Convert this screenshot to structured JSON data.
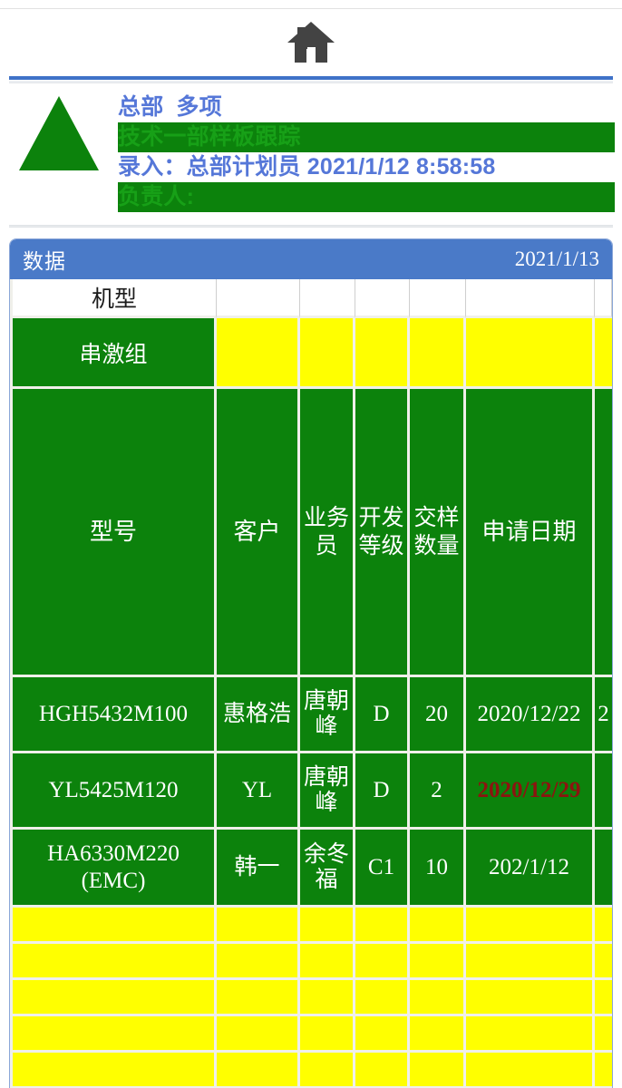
{
  "nav": {
    "home_icon": "home-icon"
  },
  "record": {
    "org_line": "总部",
    "org_type": "多项",
    "title": "技术一部样板跟踪",
    "entry_label": "录入：",
    "entry_user": "总部计划员",
    "entry_datetime": "2021/1/12 8:58:58",
    "owner_label": "负责人:",
    "marker_icon": "green-triangle-icon",
    "colors": {
      "blue": "#5577d8",
      "green": "#17a017"
    }
  },
  "panel": {
    "title": "数据",
    "date": "2021/1/13",
    "header_color": "#4a7ac8"
  },
  "table": {
    "machine_label": "机型",
    "group_label": "串激组",
    "columns": [
      {
        "key": "model",
        "label": "型号"
      },
      {
        "key": "client",
        "label": "客户"
      },
      {
        "key": "sales",
        "label": "业务员"
      },
      {
        "key": "grade",
        "label": "开发等级"
      },
      {
        "key": "qty",
        "label": "交样数量"
      },
      {
        "key": "applied",
        "label": "申请日期"
      }
    ],
    "rows": [
      {
        "model": "HGH5432M100",
        "client": "惠格浩",
        "sales": "唐朝峰",
        "grade": "D",
        "qty": "20",
        "applied": "2020/12/22",
        "applied_overdue": false,
        "extra": "2"
      },
      {
        "model": "YL5425M120",
        "client": "YL",
        "sales": "唐朝峰",
        "grade": "D",
        "qty": "2",
        "applied": "2020/12/29",
        "applied_overdue": true,
        "extra": ""
      },
      {
        "model": "HA6330M220 (EMC)",
        "model_line1": "HA6330M220",
        "model_line2": "(EMC)",
        "client": "韩一",
        "sales": "余冬福",
        "grade": "C1",
        "qty": "10",
        "applied": "202/1/12",
        "applied_overdue": false,
        "extra": ""
      }
    ],
    "empty_row_count": 5,
    "colors": {
      "cell_green": "#0c820c",
      "cell_yellow": "#ffff00",
      "overdue_text": "#8c1410",
      "gridline": "#f0f0ea"
    }
  }
}
